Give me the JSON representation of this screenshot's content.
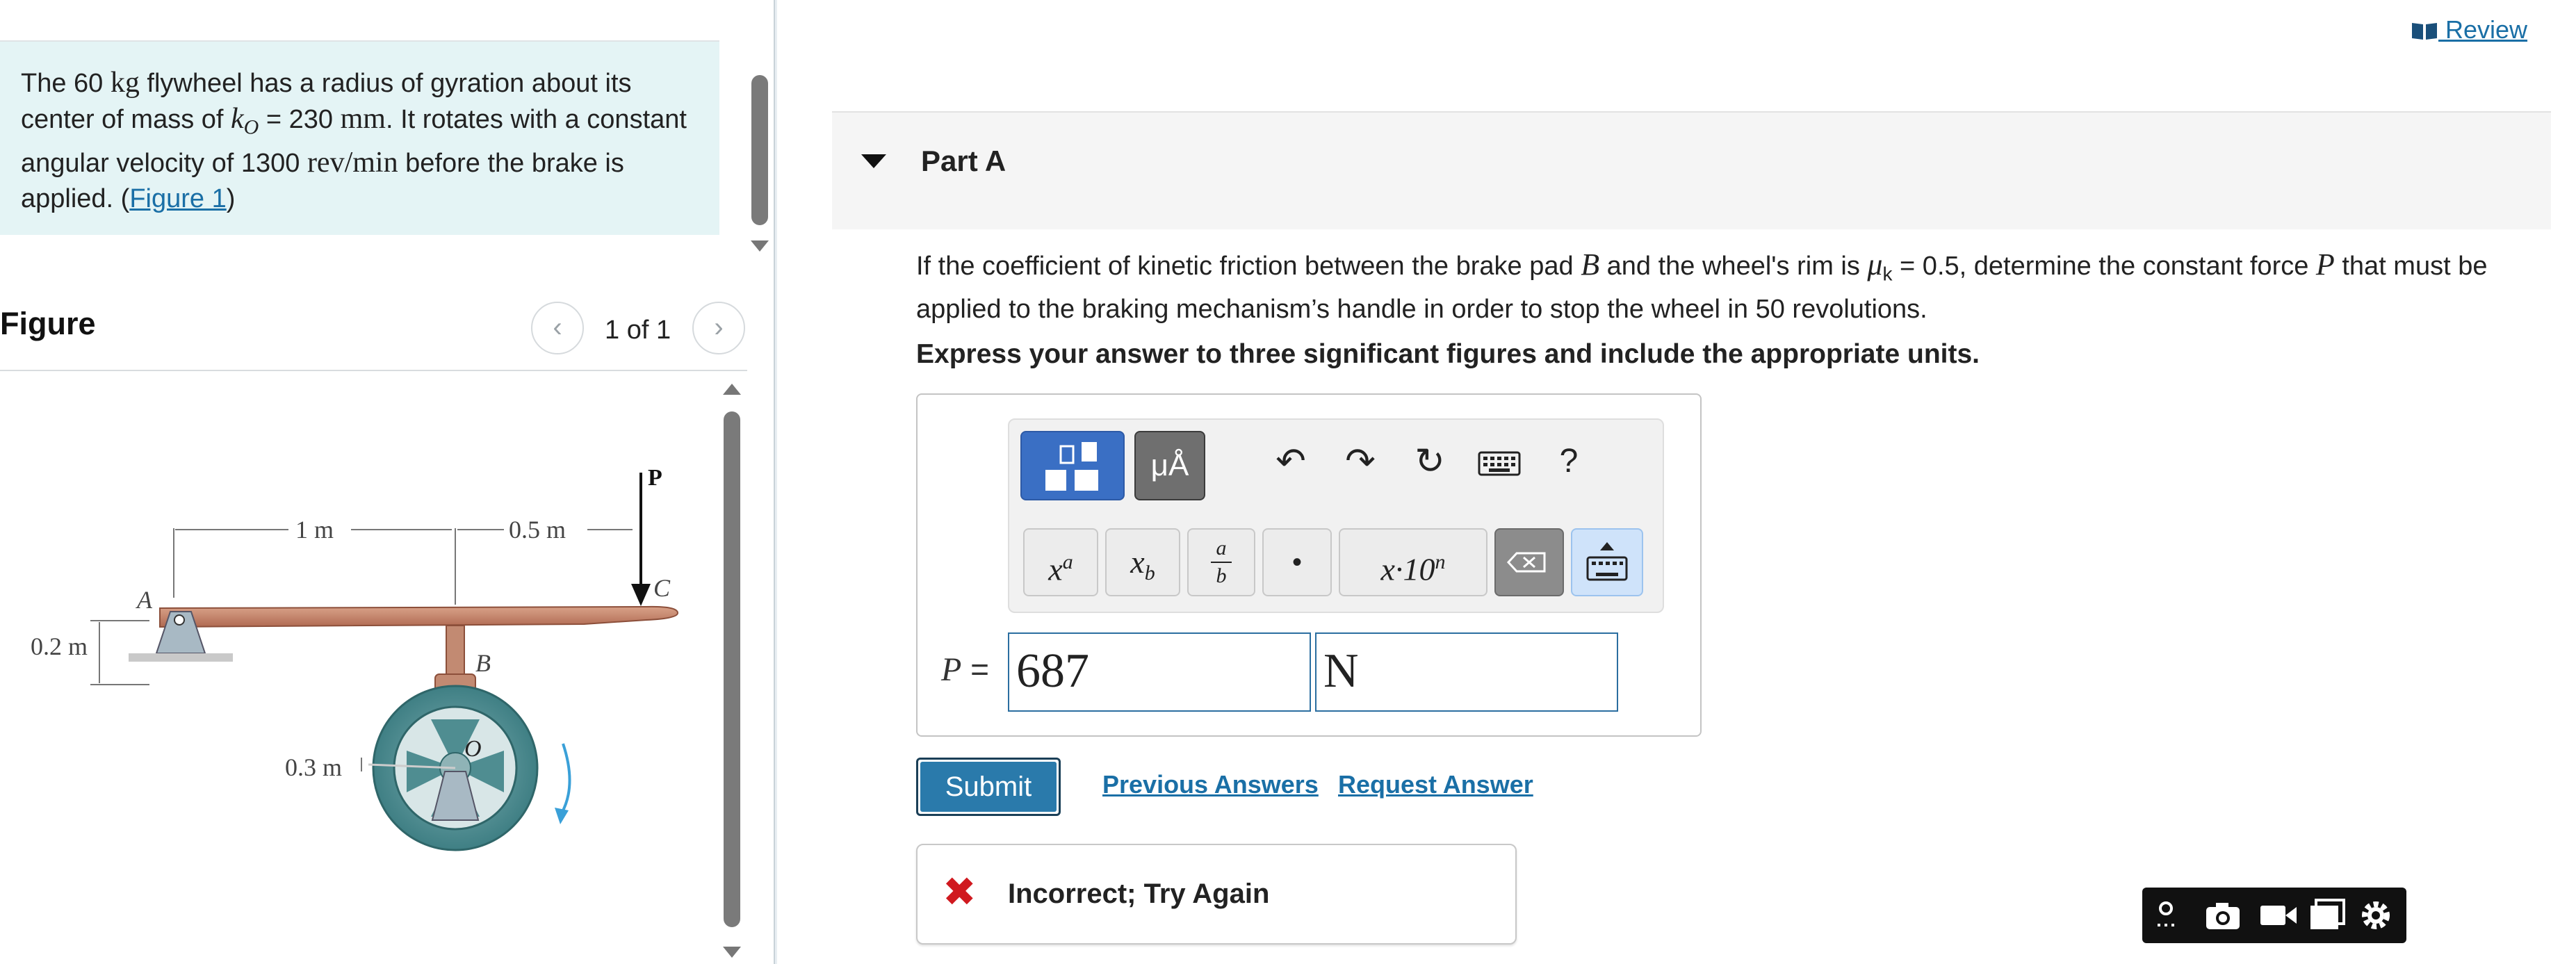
{
  "problem": {
    "p1": "The 60 ",
    "mass_unit": "kg",
    "p2": " flywheel has a radius of gyration about its center of mass of ",
    "k_symbol": "k",
    "k_sub": "O",
    "p3": " = 230 ",
    "length_unit": "mm",
    "p4": ". It rotates with a constant angular velocity of 1300 ",
    "speed_unit": "rev/min",
    "p5": " before the brake is applied. (",
    "figure_link": "Figure 1",
    "p6": ")"
  },
  "figure": {
    "title": "Figure",
    "pager": "1 of 1",
    "prev_glyph": "‹",
    "next_glyph": "›",
    "labels": {
      "dim_1m": "1 m",
      "dim_05m": "0.5 m",
      "dim_02m": "0.2 m",
      "dim_03m": "0.3 m",
      "pt_A": "A",
      "pt_B": "B",
      "pt_C": "C",
      "pt_O": "O",
      "force_P": "P"
    }
  },
  "header": {
    "review_label": " Review"
  },
  "part": {
    "title": "Part A"
  },
  "question": {
    "q1": "If the coefficient of kinetic friction between the brake pad ",
    "B": "B",
    "q2": " and the wheel's rim is ",
    "mu": "μ",
    "mu_sub": "k",
    "q3": " = 0.5, determine the constant force ",
    "P": "P",
    "q4": " that must be applied to the braking mechanism’s handle in order to stop the wheel in 50 revolutions.",
    "instructions": "Express your answer to three significant figures and include the appropriate units."
  },
  "toolbar": {
    "units_label": "μÅ",
    "undo_glyph": "↶",
    "redo_glyph": "↷",
    "reset_glyph": "↻",
    "help_label": "?",
    "sup_base": "x",
    "sup_exp": "a",
    "sub_base": "x",
    "sub_idx": "b",
    "frac_num": "a",
    "frac_den": "b",
    "dot_label": "•",
    "sci_label": "x·10",
    "sci_exp": "n"
  },
  "answer": {
    "var_label": "P",
    "equals": " =",
    "value": "687",
    "unit": "N"
  },
  "actions": {
    "submit_label": "Submit",
    "previous_answers": "Previous Answers",
    "request_answer": "Request Answer"
  },
  "feedback": {
    "icon": "✖",
    "message": "Incorrect; Try Again",
    "status_color": "#d0191f"
  },
  "colors": {
    "accent": "#1a6fa6",
    "submit_bg": "#2a7aab",
    "template_button": "#3a6fc4",
    "problem_bg": "#e4f4f5"
  }
}
